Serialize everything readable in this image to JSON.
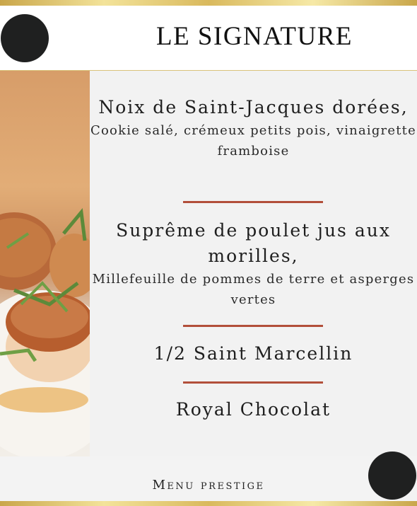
{
  "header": {
    "title": "LE SIGNATURE"
  },
  "menu": {
    "items": [
      {
        "name": "Noix de Saint-Jacques dorées,",
        "description": "Cookie salé, crémeux petits pois, vinaigrette framboise"
      },
      {
        "name": "Suprême de poulet jus aux morilles,",
        "description": "Millefeuille de pommes de terre et asperges vertes"
      },
      {
        "name": "1/2 Saint Marcellin"
      },
      {
        "name": "Royal Chocolat"
      }
    ]
  },
  "footer": {
    "label": "Menu   prestige"
  },
  "colors": {
    "gold": "#d9b95d",
    "separator": "#b24f3a",
    "dot": "#1f2020"
  }
}
